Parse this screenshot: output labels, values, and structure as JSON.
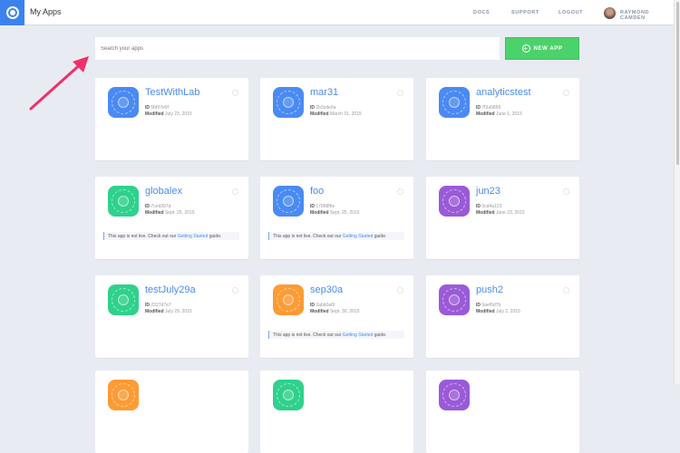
{
  "header": {
    "title": "My Apps",
    "nav": [
      "DOCS",
      "SUPPORT",
      "LOGOUT"
    ],
    "user": "RAYMOND CAMDEN"
  },
  "search": {
    "placeholder": "Search your apps"
  },
  "new_app_label": "NEW APP",
  "labels": {
    "id": "ID",
    "modified": "Modified",
    "notice_pre": "This app is not live. Check out our",
    "notice_link": "Getting Started",
    "notice_post": "guide."
  },
  "colors": {
    "blue": "#4a8af4",
    "green": "#2fd18c",
    "purple": "#9a5ad8",
    "orange": "#fd9b35"
  },
  "apps": [
    {
      "name": "TestWithLab",
      "id": "5fd97e9f",
      "modified": "July 23, 2015",
      "color": "#4a8af4",
      "live": true
    },
    {
      "name": "mar31",
      "id": "2b3cde0a",
      "modified": "March 31, 2015",
      "color": "#4a8af4",
      "live": true
    },
    {
      "name": "analyticstest",
      "id": "7f3a5856",
      "modified": "June 1, 2015",
      "color": "#4a8af4",
      "live": true
    },
    {
      "name": "globalex",
      "id": "7ced397d",
      "modified": "Sept. 25, 2015",
      "color": "#2fd18c",
      "live": false
    },
    {
      "name": "foo",
      "id": "176fd86e",
      "modified": "Sept. 25, 2015",
      "color": "#4a8af4",
      "live": false
    },
    {
      "name": "jun23",
      "id": "0cd4a123",
      "modified": "June 23, 2015",
      "color": "#9a5ad8",
      "live": true
    },
    {
      "name": "testJuly29a",
      "id": "2327d7e7",
      "modified": "July 29, 2015",
      "color": "#2fd18c",
      "live": true
    },
    {
      "name": "sep30a",
      "id": "2abb0a6f",
      "modified": "Sept. 30, 2015",
      "color": "#fd9b35",
      "live": false
    },
    {
      "name": "push2",
      "id": "6aef0d7b",
      "modified": "July 2, 2015",
      "color": "#9a5ad8",
      "live": true
    },
    {
      "color": "#fd9b35"
    },
    {
      "color": "#2fd18c"
    },
    {
      "color": "#9a5ad8"
    }
  ]
}
